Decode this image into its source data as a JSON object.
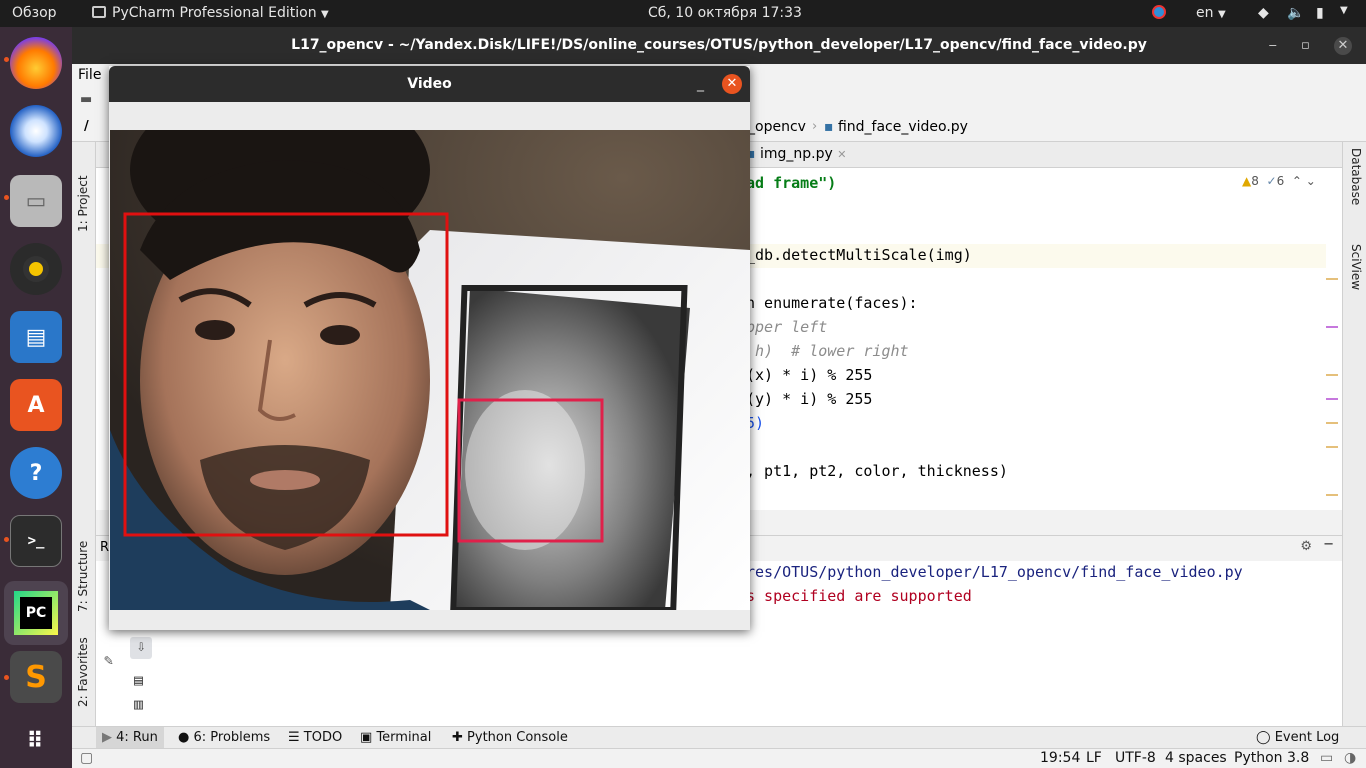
{
  "topbar": {
    "activities": "Обзор",
    "app_name": "PyCharm Professional Edition",
    "clock": "Сб, 10 октября  17:33",
    "lang": "en"
  },
  "ide": {
    "title": "L17_opencv - ~/Yandex.Disk/LIFE!/DS/online_courses/OTUS/python_developer/L17_opencv/find_face_video.py",
    "menu_file": "File",
    "breadcrumb_folder": "_opencv",
    "breadcrumb_file": "find_face_video.py",
    "tab_file": "img_np.py",
    "warnings": "8",
    "weak_warnings": "6",
    "right_tools": [
      "Database",
      "SciView"
    ],
    "left_tools": [
      "1: Project",
      "7: Structure",
      "2: Favorites"
    ],
    "code_lines": [
      {
        "text": "ad frame\")",
        "cls": "str"
      },
      {
        "text": "_db.detectMultiScale(img)",
        "cls": ""
      },
      {
        "text": "n enumerate(faces):",
        "cls": ""
      },
      {
        "text": "pper left",
        "cls": "cmt"
      },
      {
        "text": " h)  # lower right",
        "cls": "cmt"
      },
      {
        "text": "(x) * i) % 255",
        "cls": ""
      },
      {
        "text": "(y) * i) % 255",
        "cls": ""
      },
      {
        "text": "5)",
        "cls": ""
      },
      {
        "text": ", pt1, pt2, color, thickness)",
        "cls": ""
      }
    ],
    "run_label": "R",
    "console_lines": [
      {
        "text": "res/OTUS/python_developer/L17_opencv/find_face_video.py",
        "color": "#1a237e"
      },
      {
        "text": "s specified are supported",
        "color": "#b00020"
      }
    ],
    "bottom_tabs": {
      "run": "4: Run",
      "problems": "6: Problems",
      "todo": "TODO",
      "terminal": "Terminal",
      "python_console": "Python Console",
      "event_log": "Event Log"
    },
    "status": {
      "position": "19:54",
      "line_sep": "LF",
      "encoding": "UTF-8",
      "indent": "4 spaces",
      "interpreter": "Python 3.8"
    }
  },
  "video_window": {
    "title": "Video",
    "face_box_1_color": "#e01010",
    "face_box_2_color": "#e0204a"
  },
  "colors": {
    "dock_bg": "#3a2c38",
    "accent": "#e95420"
  }
}
